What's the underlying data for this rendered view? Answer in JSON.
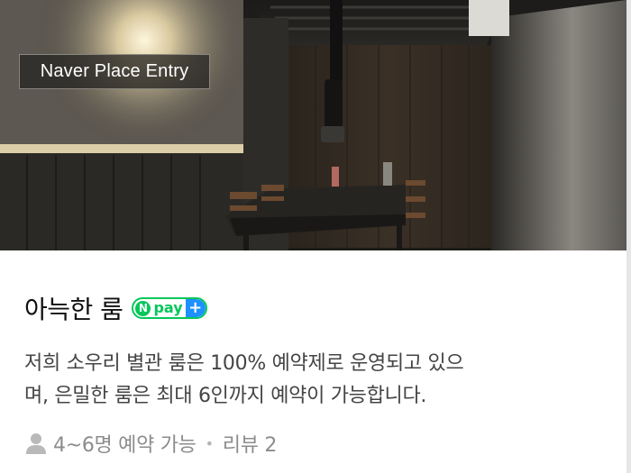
{
  "photo": {
    "badge_label": "Naver Place Entry"
  },
  "room": {
    "title": "아늑한 룸",
    "pay_badge": {
      "n": "N",
      "text": "pay",
      "plus": "+"
    },
    "description_line1": "저희 소우리 별관 룸은 100% 예약제로 운영되고 있으",
    "description_line2": "며, 은밀한 룸은 최대 6인까지 예약이 가능합니다.",
    "capacity": "4~6명 예약 가능",
    "separator": "•",
    "reviews": "리뷰 2"
  },
  "colors": {
    "npay_green": "#03c75a",
    "npay_plus_blue": "#1e90ff",
    "title_text": "#111111",
    "description_text": "#444444",
    "meta_text": "#8c8c8c"
  },
  "icons": {
    "capacity_icon": "person-icon"
  }
}
